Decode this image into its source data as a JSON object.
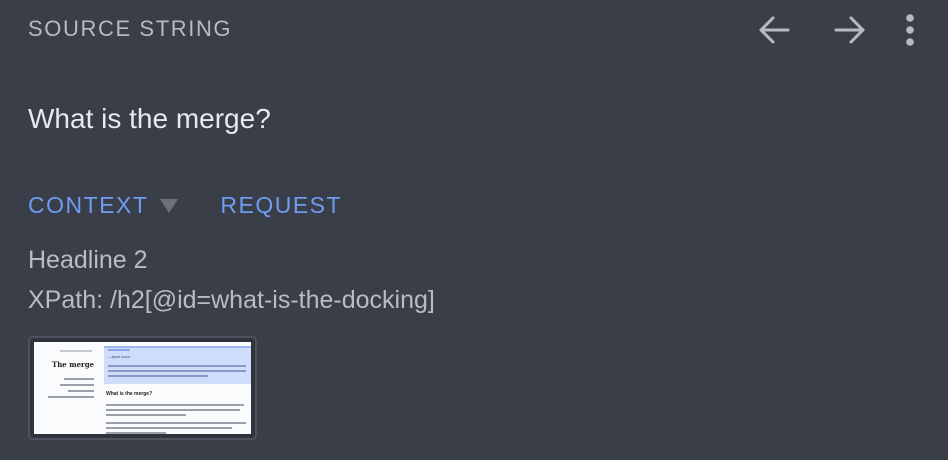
{
  "header": {
    "label": "SOURCE STRING",
    "back_icon": "arrow-left-icon",
    "forward_icon": "arrow-right-icon",
    "more_icon": "more-vertical-icon"
  },
  "source": {
    "text": "What is the merge?"
  },
  "tabs": [
    {
      "label": "CONTEXT"
    },
    {
      "label": "REQUEST"
    }
  ],
  "context": {
    "type_line": "Headline 2",
    "xpath_line": "XPath: /h2[@id=what-is-the-docking]"
  },
  "thumbnail": {
    "page_title": "The merge",
    "box_title": "—ерге сооо",
    "heading": "What is the merge?"
  },
  "colors": {
    "background": "#393e49",
    "accent": "#6f9cf0",
    "text_primary": "#e7e9ed",
    "text_secondary": "#b8bcc4"
  }
}
